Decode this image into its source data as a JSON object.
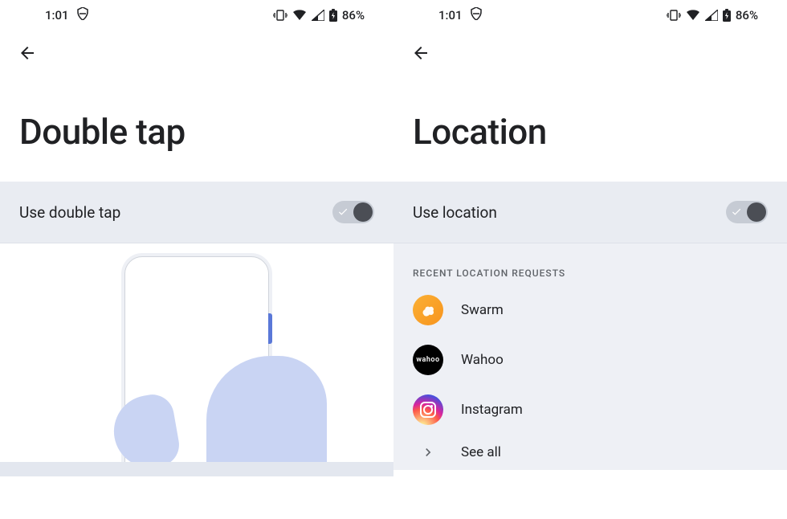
{
  "status": {
    "time": "1:01",
    "battery_text": "86%"
  },
  "left": {
    "title": "Double tap",
    "toggle_label": "Use double tap",
    "toggle_on": true
  },
  "right": {
    "title": "Location",
    "toggle_label": "Use location",
    "toggle_on": true,
    "section_header": "RECENT LOCATION REQUESTS",
    "apps": [
      {
        "name": "Swarm",
        "icon": "swarm"
      },
      {
        "name": "Wahoo",
        "icon": "wahoo"
      },
      {
        "name": "Instagram",
        "icon": "instagram"
      }
    ],
    "see_all_label": "See all"
  }
}
